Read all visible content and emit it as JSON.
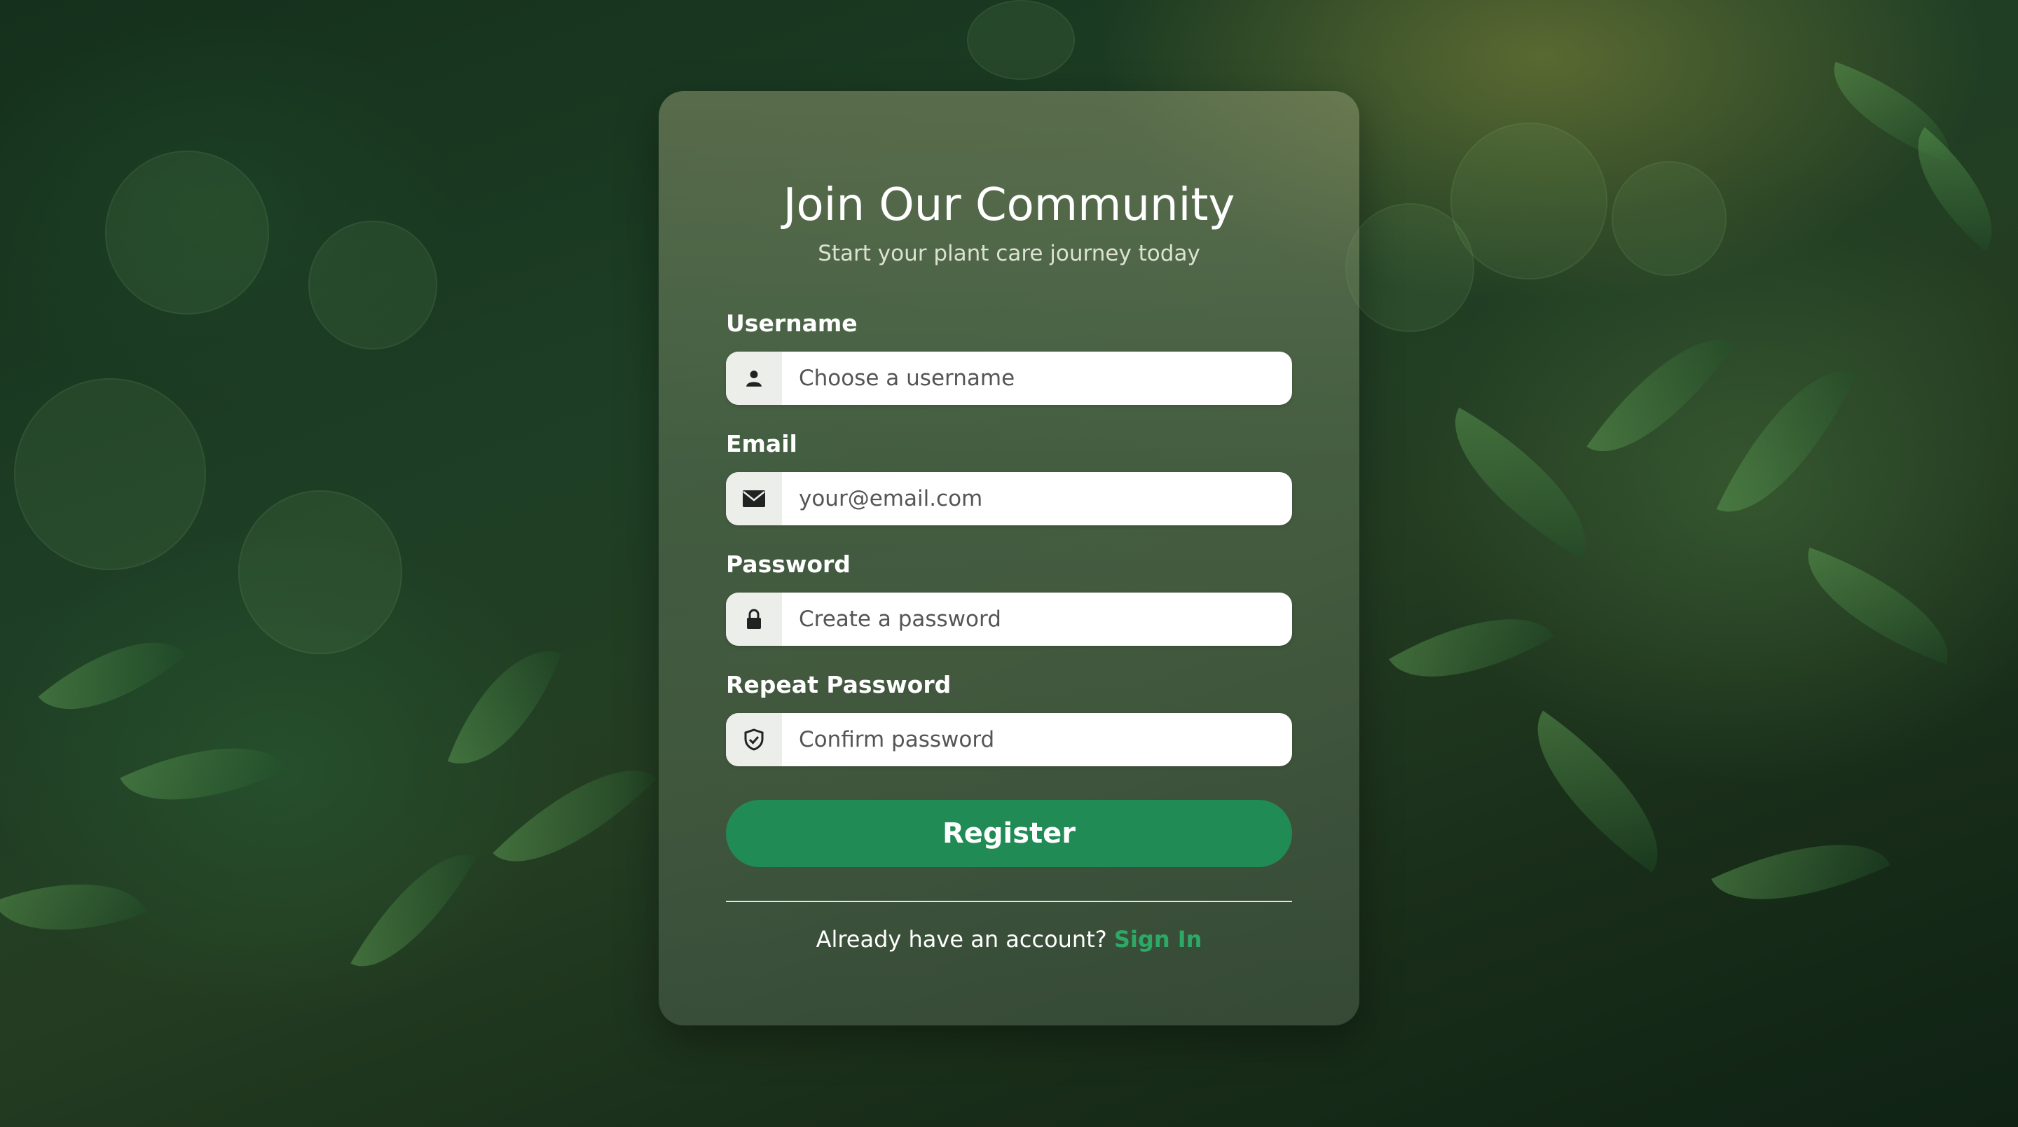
{
  "form": {
    "title": "Join Our Community",
    "subtitle": "Start your plant care journey today",
    "fields": [
      {
        "label": "Username",
        "placeholder": "Choose a username",
        "icon": "user-icon"
      },
      {
        "label": "Email",
        "placeholder": "your@email.com",
        "icon": "envelope-icon"
      },
      {
        "label": "Password",
        "placeholder": "Create a password",
        "icon": "lock-icon"
      },
      {
        "label": "Repeat Password",
        "placeholder": "Confirm password",
        "icon": "shield-check-icon"
      }
    ],
    "register_label": "Register",
    "footer_text": "Already have an account?",
    "signin_label": "Sign In"
  },
  "colors": {
    "accent": "#218b55",
    "link": "#2ea866"
  }
}
